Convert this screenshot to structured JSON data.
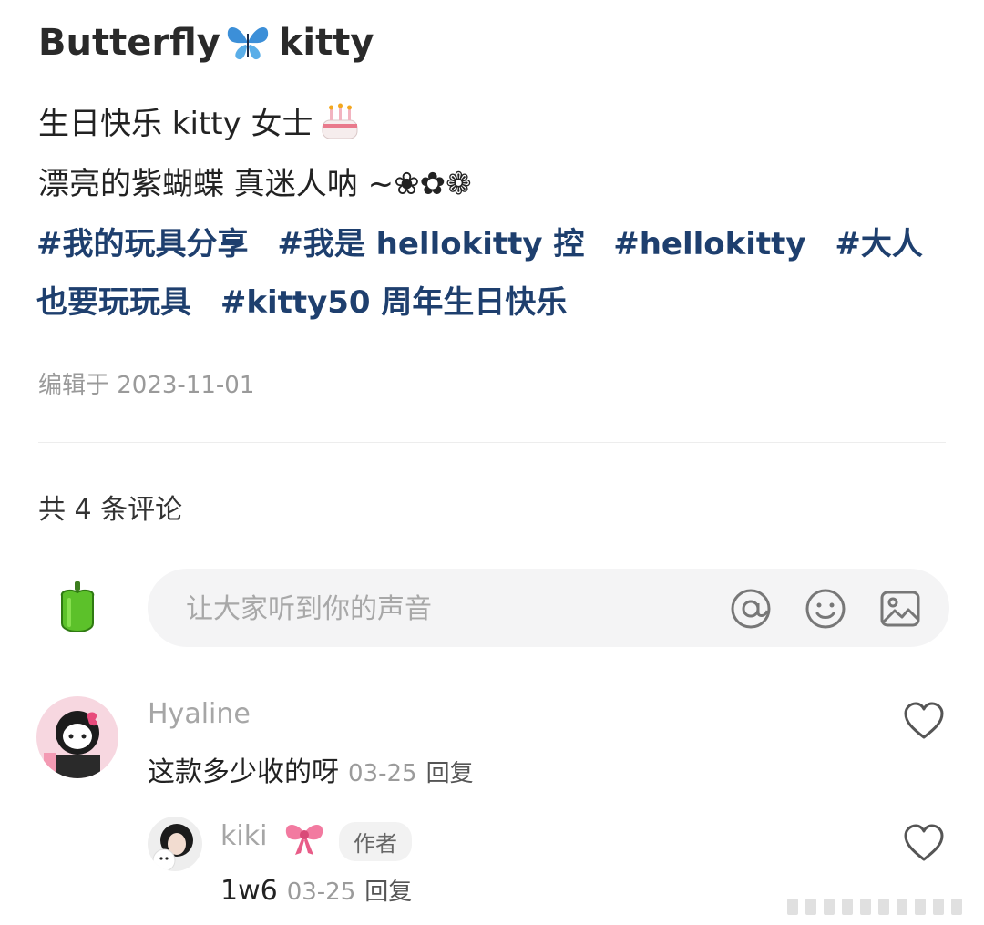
{
  "post": {
    "title_part1": "Butterfly",
    "title_part2": "kitty",
    "line1": "生日快乐 kitty 女士",
    "line2": "漂亮的紫蝴蝶 真迷人呐 ~❀✿❁",
    "tags": [
      "#我的玩具分享",
      "#我是 hellokitty 控",
      "#hellokitty",
      "#大人也要玩玩具",
      "#kitty50 周年生日快乐"
    ],
    "edited": "编辑于 2023-11-01"
  },
  "comments_section": {
    "count_label": "共 4 条评论",
    "input_placeholder": "让大家听到你的声音",
    "comments": [
      {
        "user": "Hyaline",
        "text": "这款多少收的呀",
        "date": "03-25",
        "reply_label": "回复"
      }
    ],
    "reply": {
      "user": "kiki",
      "badge": "作者",
      "text": "1w6",
      "date": "03-25",
      "reply_label": "回复"
    }
  },
  "icons": {
    "butterfly": "butterfly-emoji-icon",
    "cake": "cake-emoji-icon",
    "pepper": "pepper-avatar-icon",
    "at": "at-icon",
    "emoji": "smiley-icon",
    "image": "image-icon",
    "heart": "heart-outline-icon",
    "bow": "bow-emoji-icon"
  },
  "colors": {
    "tag": "#1e3f6e",
    "muted": "#9b9b9b",
    "input_bg": "#f4f4f5"
  }
}
